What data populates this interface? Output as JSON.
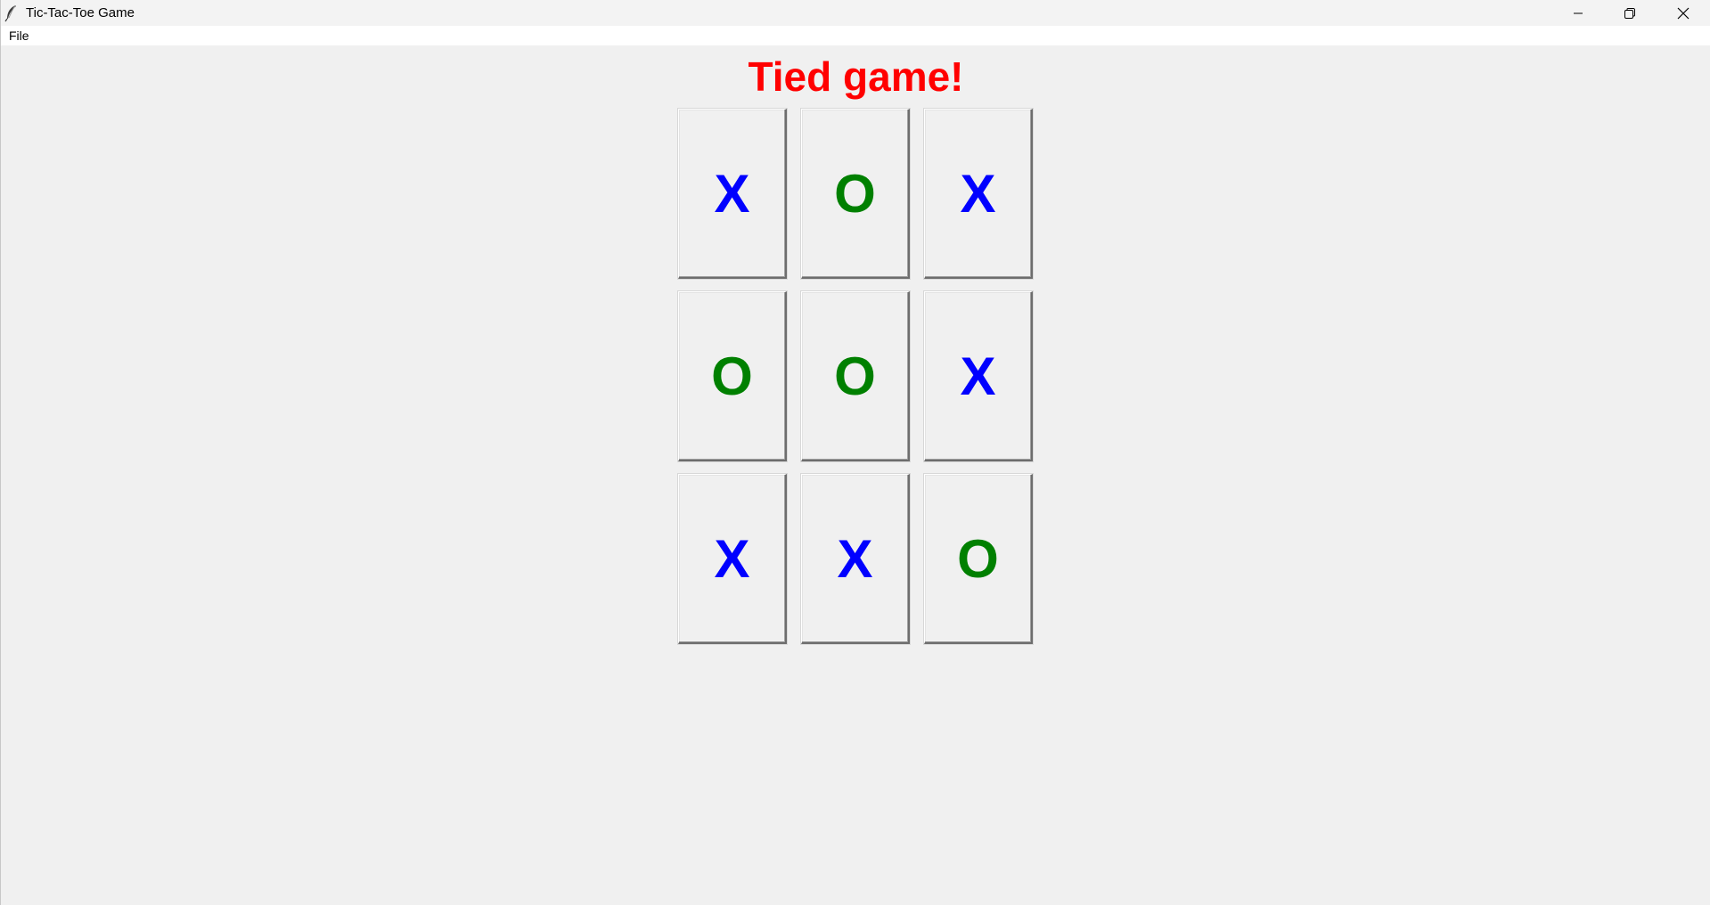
{
  "window": {
    "title": "Tic-Tac-Toe Game",
    "icon": "feather-icon",
    "controls": {
      "minimize_icon": "minimize-icon",
      "maximize_icon": "restore-icon",
      "close_icon": "close-icon"
    }
  },
  "menubar": {
    "items": [
      {
        "label": "File"
      }
    ]
  },
  "status": {
    "text": "Tied game!",
    "color": "#ff0000"
  },
  "colors": {
    "X": "#0000ff",
    "O": "#008000"
  },
  "board": {
    "cells": [
      "X",
      "O",
      "X",
      "O",
      "O",
      "X",
      "X",
      "X",
      "O"
    ]
  }
}
